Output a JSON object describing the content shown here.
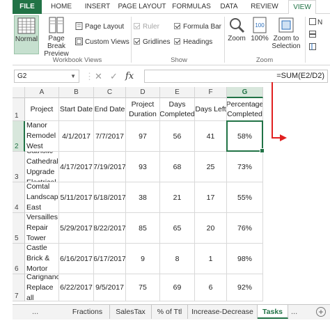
{
  "ribbon_tabs": [
    {
      "label": "FILE",
      "kind": "file"
    },
    {
      "label": "HOME",
      "kind": "normal"
    },
    {
      "label": "INSERT",
      "kind": "normal"
    },
    {
      "label": "PAGE LAYOUT",
      "kind": "normal"
    },
    {
      "label": "FORMULAS",
      "kind": "normal"
    },
    {
      "label": "DATA",
      "kind": "normal"
    },
    {
      "label": "REVIEW",
      "kind": "normal"
    },
    {
      "label": "VIEW",
      "kind": "active"
    }
  ],
  "ribbon": {
    "normal": "Normal",
    "page_break_preview": "Page Break Preview",
    "page_layout": "Page Layout",
    "custom_views": "Custom Views",
    "workbook_views_group": "Workbook Views",
    "ruler": "Ruler",
    "formula_bar": "Formula Bar",
    "gridlines": "Gridlines",
    "headings": "Headings",
    "show_group": "Show",
    "zoom": "Zoom",
    "zoom_100": "100%",
    "zoom_to_selection": "Zoom to Selection",
    "zoom_group": "Zoom",
    "partial_n": "N"
  },
  "formula_bar": {
    "name_box": "G2",
    "cancel_icon": "✕",
    "enter_icon": "✓",
    "fx_label": "fx",
    "formula": "=SUM(E2/D2)"
  },
  "columns": [
    "A",
    "B",
    "C",
    "D",
    "E",
    "F",
    "G"
  ],
  "selected_column": "G",
  "header_row": [
    "Project",
    "Start Date",
    "End Date",
    "Project Duration",
    "Days Completed",
    "Days Left",
    "Percentage Completed"
  ],
  "rows": [
    {
      "num": "1"
    },
    {
      "num": "2",
      "cells": [
        "Greystoke Manor Remodel West Wing",
        "4/1/2017",
        "7/7/2017",
        "97",
        "56",
        "41",
        "58%"
      ]
    },
    {
      "num": "3",
      "cells": [
        "Catholic Cathedral Upgrade Electrical",
        "4/17/2017",
        "7/19/2017",
        "93",
        "68",
        "25",
        "73%"
      ]
    },
    {
      "num": "4",
      "cells": [
        "Château Comtal Landscape East Garden",
        "5/11/2017",
        "6/18/2017",
        "38",
        "21",
        "17",
        "55%"
      ]
    },
    {
      "num": "5",
      "cells": [
        "Palace of Versailles Repair Tower Spires",
        "5/29/2017",
        "8/22/2017",
        "85",
        "65",
        "20",
        "76%"
      ]
    },
    {
      "num": "6",
      "cells": [
        "Blarney Castle Brick & Mortor Repair",
        "6/16/2017",
        "6/17/2017",
        "9",
        "8",
        "1",
        "98%"
      ]
    },
    {
      "num": "7",
      "cells": [
        "Palazzo Carignano Replace all Windows",
        "6/22/2017",
        "9/5/2017",
        "75",
        "69",
        "6",
        "92%"
      ]
    }
  ],
  "sheet_tabs": [
    {
      "label": "Fractions",
      "active": false
    },
    {
      "label": "SalesTax",
      "active": false
    },
    {
      "label": "% of Ttl",
      "active": false
    },
    {
      "label": "Increase-Decrease",
      "active": false
    },
    {
      "label": "Tasks",
      "active": true
    }
  ],
  "sheet_ellipsis": "...",
  "add_sheet": "+",
  "colors": {
    "accent": "#217346",
    "annotation": "#e02020"
  }
}
